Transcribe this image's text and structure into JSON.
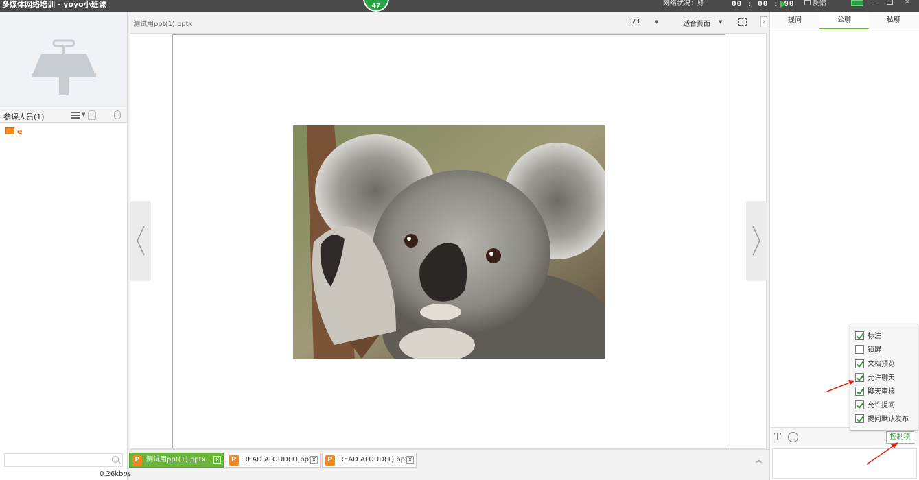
{
  "window": {
    "title": "多媒体网络培训 - yoyo小班课",
    "counter": "47",
    "network_label": "网络状况：好",
    "timer": "00 : 00 : 00",
    "feedback_label": "反馈"
  },
  "left_panel": {
    "attendees_label": "参课人员(1)",
    "attendee_name": "e",
    "search_placeholder": ""
  },
  "document": {
    "name": "测试用ppt(1).pptx",
    "page_indicator": "1/3",
    "fit_mode": "适合页面"
  },
  "doc_tabs": [
    {
      "label": "测试用ppt(1).pptx",
      "active": true
    },
    {
      "label": "READ  ALOUD(1).ppt",
      "active": false
    },
    {
      "label": "READ  ALOUD(1).ppt",
      "active": false
    }
  ],
  "bottom_bar": {
    "bitrate": "0.26kbps"
  },
  "chat": {
    "tabs": [
      "提问",
      "公聊",
      "私聊"
    ],
    "active_tab": "公聊",
    "control_button": "控制项"
  },
  "control_options": [
    {
      "label": "标注",
      "checked": true
    },
    {
      "label": "锁屏",
      "checked": false
    },
    {
      "label": "文档预览",
      "checked": true
    },
    {
      "label": "允许聊天",
      "checked": true
    },
    {
      "label": "聊天审核",
      "checked": true
    },
    {
      "label": "允许提问",
      "checked": true
    },
    {
      "label": "提问默认发布",
      "checked": true
    }
  ],
  "colors": {
    "accent_green": "#6bb53b",
    "titlebar": "#4a4a4a",
    "ppt_orange": "#f08a1f",
    "annotation_red": "#d9261c"
  }
}
